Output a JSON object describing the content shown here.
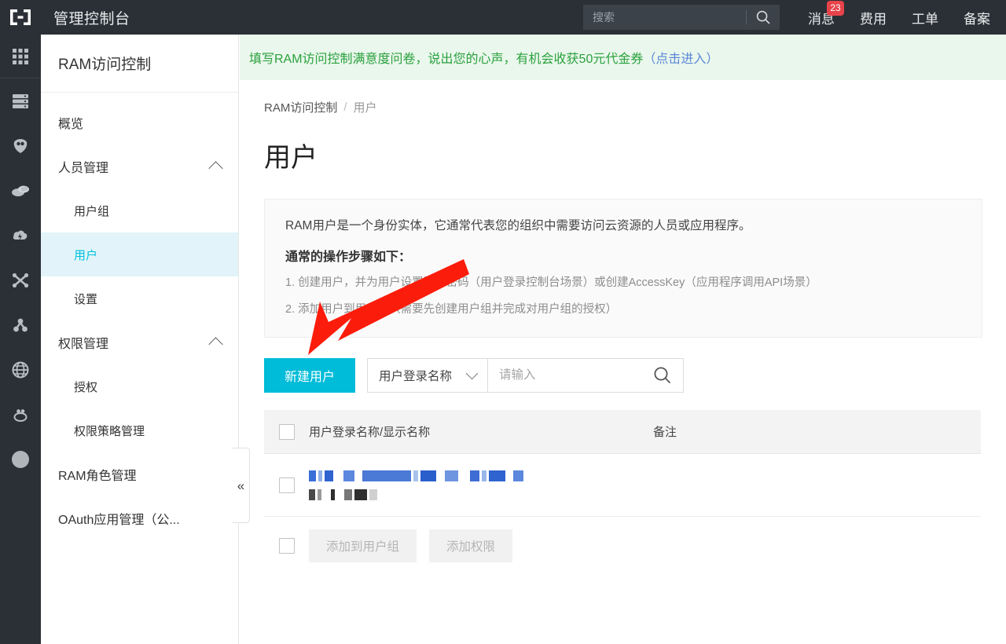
{
  "header": {
    "logo_icon": "console-bracket-logo",
    "title": "管理控制台",
    "search": {
      "placeholder": "搜索",
      "icon": "search-icon",
      "value": ""
    },
    "nav": [
      {
        "label": "消息",
        "badge": "23"
      },
      {
        "label": "费用",
        "badge": ""
      },
      {
        "label": "工单",
        "badge": ""
      },
      {
        "label": "备案",
        "badge": ""
      }
    ]
  },
  "icon_rail": [
    {
      "name": "app-grid-icon"
    },
    {
      "name": "server-icon"
    },
    {
      "name": "shield-icon"
    },
    {
      "name": "cloud-stack-icon"
    },
    {
      "name": "cloud-lightning-icon"
    },
    {
      "name": "cross-nodes-icon"
    },
    {
      "name": "network-share-icon"
    },
    {
      "name": "globe-icon"
    },
    {
      "name": "bug-icon"
    },
    {
      "name": "circle-avatar-icon"
    }
  ],
  "sidebar": {
    "title": "RAM访问控制",
    "items": [
      {
        "label": "概览",
        "type": "item",
        "active": false
      },
      {
        "label": "人员管理",
        "type": "group",
        "expanded": true
      },
      {
        "label": "用户组",
        "type": "child",
        "active": false
      },
      {
        "label": "用户",
        "type": "child",
        "active": true
      },
      {
        "label": "设置",
        "type": "child",
        "active": false
      },
      {
        "label": "权限管理",
        "type": "group",
        "expanded": true
      },
      {
        "label": "授权",
        "type": "child",
        "active": false
      },
      {
        "label": "权限策略管理",
        "type": "child",
        "active": false
      },
      {
        "label": "RAM角色管理",
        "type": "item",
        "active": false
      },
      {
        "label": "OAuth应用管理（公...",
        "type": "item",
        "active": false
      }
    ],
    "collapse_icon": "double-chevron-left-icon"
  },
  "banner": {
    "text": "填写RAM访问控制满意度问卷，说出您的心声，有机会收获50元代金券",
    "link": "（点击进入）",
    "bg_color": "#eaf7ec",
    "text_color": "#2aa13e",
    "link_color": "#5a87d8"
  },
  "breadcrumb": {
    "root": "RAM访问控制",
    "separator": "/",
    "current": "用户"
  },
  "page": {
    "title": "用户"
  },
  "info_card": {
    "lead": "RAM用户是一个身份实体，它通常代表您的组织中需要访问云资源的人员或应用程序。",
    "subtitle": "通常的操作步骤如下：",
    "steps": [
      "1. 创建用户，并为用户设置登录密码（用户登录控制台场景）或创建AccessKey（应用程序调用API场景）",
      "2. 添加用户到用户组（需要先创建用户组并完成对用户组的授权）"
    ]
  },
  "toolbar": {
    "create_button": "新建用户",
    "create_button_color": "#00bcd8",
    "filter_field": "用户登录名称",
    "filter_chevron_icon": "chevron-down-icon",
    "keyword_placeholder": "请输入",
    "keyword_value": "",
    "search_icon": "search-icon"
  },
  "table": {
    "columns": [
      "用户登录名称/显示名称",
      "备注"
    ],
    "rows": [
      {
        "login_name": "",
        "display_name": "",
        "note": "",
        "redacted": true
      }
    ]
  },
  "row_actions": {
    "buttons": [
      {
        "label": "添加到用户组",
        "disabled": true
      },
      {
        "label": "添加权限",
        "disabled": true
      }
    ]
  },
  "annotation": {
    "arrow_color": "#fc1c0b",
    "points_to": "新建用户"
  }
}
